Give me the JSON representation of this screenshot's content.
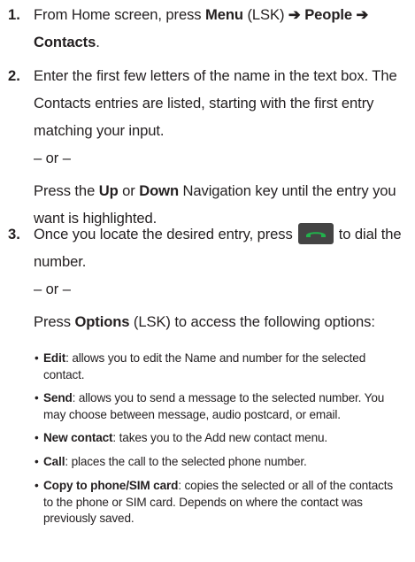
{
  "steps": [
    {
      "number": "1.",
      "line1_pre": "From Home screen, press ",
      "menu": "Menu",
      "lsk1": " (LSK) ",
      "arrow1": "➔",
      "people": " People ",
      "arrow2": "➔",
      "contacts": "Contacts",
      "period": "."
    },
    {
      "number": "2.",
      "p1_line1": "Enter the first few letters of the name in the text box. The",
      "p1_line2": "Contacts entries are listed, starting with the first entry",
      "p1_line3": "matching your input.",
      "or": "– or –",
      "p2_pre": "Press the ",
      "up": "Up",
      "or_word": " or ",
      "down": "Down",
      "p2_post": " Navigation key until the entry you",
      "p2_line2": "want is highlighted."
    },
    {
      "number": "3.",
      "p1_pre": "Once you locate the desired entry, press",
      "p1_post": "to dial the",
      "p1_line2": "number.",
      "or": "– or –",
      "p2_pre": "Press ",
      "options": "Options",
      "p2_post": " (LSK) to access the following options:",
      "call_key_icon": "send-call-key-icon"
    }
  ],
  "bullets": [
    {
      "term": "Edit",
      "line1": ": allows you to edit the Name and number for the selected",
      "line2": "contact."
    },
    {
      "term": "Send",
      "line1": ": allows you to send a message to the selected number. You",
      "line2": "may choose between message, audio postcard, or email."
    },
    {
      "term": "New contact",
      "line1": ": takes you to the Add new contact menu."
    },
    {
      "term": "Call",
      "line1": ": places the call to the selected phone number."
    },
    {
      "term": "Copy to phone/SIM card",
      "line1": ": copies the selected or all of the contacts",
      "line2": "to the phone or SIM card. Depends on where the contact was",
      "line3": "previously saved."
    }
  ],
  "bullet_glyph": "•",
  "colors": {
    "text": "#231f20",
    "call_key_bg": "#444444",
    "call_key_icon": "#22b14c"
  }
}
